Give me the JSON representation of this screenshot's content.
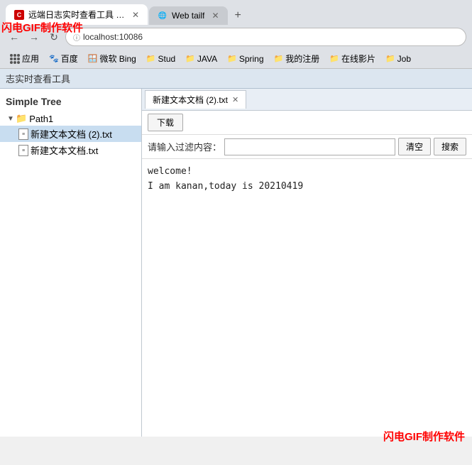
{
  "browser": {
    "tabs": [
      {
        "id": "tab1",
        "favicon_type": "c-icon",
        "favicon_label": "C",
        "label": "远端日志实时查看工具 Web-tail ...",
        "active": true,
        "closable": true
      },
      {
        "id": "tab2",
        "favicon_type": "globe-icon",
        "favicon_label": "🌐",
        "label": "Web tailf",
        "active": false,
        "closable": true
      }
    ],
    "address": "localhost:10086",
    "bookmarks": [
      {
        "icon": "apps",
        "label": "应用"
      },
      {
        "icon": "🐾",
        "label": "百度"
      },
      {
        "icon": "🪟",
        "label": "微软 Bing"
      },
      {
        "icon": "📁",
        "label": "Stud"
      },
      {
        "icon": "📁",
        "label": "JAVA"
      },
      {
        "icon": "📁",
        "label": "Spring"
      },
      {
        "icon": "📁",
        "label": "我的注册"
      },
      {
        "icon": "📁",
        "label": "在线影片"
      },
      {
        "icon": "📁",
        "label": "Job"
      }
    ]
  },
  "watermark_top": "闪电GIF制作软件",
  "watermark_bottom": "闪电GIF制作软件",
  "app_header": "志实时查看工具",
  "sidebar": {
    "title": "Simple Tree",
    "tree": [
      {
        "type": "folder",
        "label": "Path1",
        "expanded": true,
        "children": [
          {
            "type": "file",
            "label": "新建文本文档 (2).txt",
            "selected": true
          },
          {
            "type": "file",
            "label": "新建文本文档.txt",
            "selected": false
          }
        ]
      }
    ]
  },
  "main": {
    "active_tab": "新建文本文档 (2).txt",
    "toolbar": {
      "download_label": "下载"
    },
    "filter": {
      "label": "请输入过滤内容：",
      "placeholder": "",
      "clear_label": "清空",
      "search_label": "搜索"
    },
    "content_lines": [
      "welcome!",
      "I am kanan,today is 20210419"
    ]
  }
}
